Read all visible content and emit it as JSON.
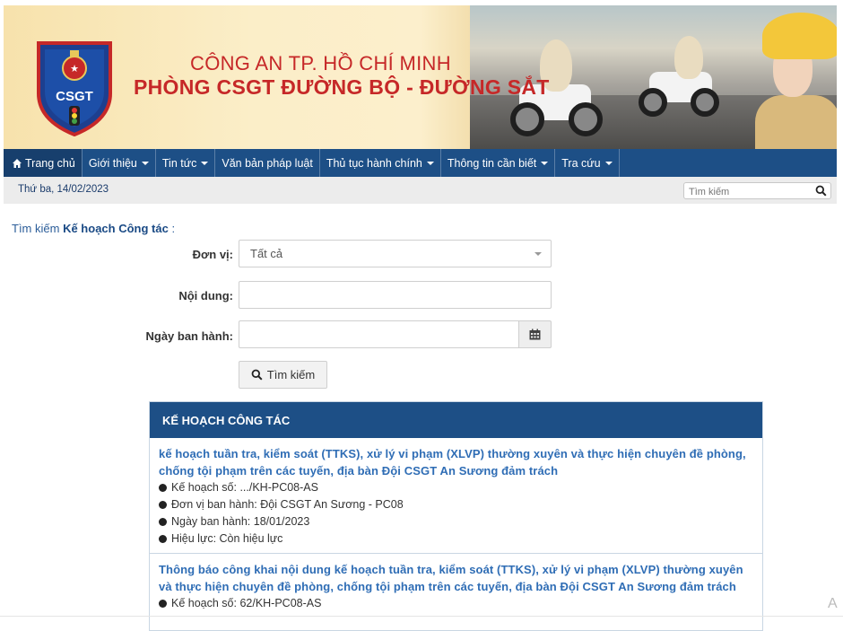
{
  "header": {
    "logo_text": "CSGT",
    "title_line1": "CÔNG AN TP. HỒ CHÍ MINH",
    "title_line2": "PHÒNG CSGT ĐƯỜNG BỘ - ĐƯỜNG SẮT"
  },
  "nav": {
    "items": [
      {
        "label": "Trang chủ",
        "icon": "home-icon",
        "dropdown": false
      },
      {
        "label": "Giới thiệu",
        "dropdown": true
      },
      {
        "label": "Tin tức",
        "dropdown": true
      },
      {
        "label": "Văn bản pháp luật",
        "dropdown": false
      },
      {
        "label": "Thủ tục hành chính",
        "dropdown": true
      },
      {
        "label": "Thông tin cần biết",
        "dropdown": true
      },
      {
        "label": "Tra cứu",
        "dropdown": true
      }
    ]
  },
  "subbar": {
    "date": "Thứ ba, 14/02/2023",
    "search_placeholder": "Tìm kiếm"
  },
  "form": {
    "title_prefix": "Tìm kiếm",
    "title_bold": "Kế hoạch Công tác",
    "title_suffix": " :",
    "unit_label": "Đơn vị:",
    "unit_value": "Tất cả",
    "content_label": "Nội dung:",
    "content_value": "",
    "date_label": "Ngày ban hành:",
    "date_value": "",
    "search_button": "Tìm kiếm"
  },
  "panel": {
    "heading": "KẾ HOẠCH CÔNG TÁC",
    "entries": [
      {
        "title": "kế hoạch tuần tra, kiểm soát (TTKS), xử lý vi phạm (XLVP) thường xuyên và thực hiện chuyên đề phòng, chống tội phạm trên các tuyến, địa bàn Đội CSGT An Sương đảm trách",
        "plan_no": "Kế hoạch số: .../KH-PC08-AS",
        "issuer": "Đơn vị ban hành: Đội CSGT An Sương - PC08",
        "issued_date": "Ngày ban hành: 18/01/2023",
        "status": "Hiệu lực: Còn hiệu lực"
      },
      {
        "title": "Thông báo công khai nội dung kế hoạch tuần tra, kiểm soát (TTKS), xử lý vi phạm (XLVP) thường xuyên và thực hiện chuyên đề phòng, chống tội phạm trên các tuyến, địa bàn Đội CSGT An Sương đảm trách",
        "plan_no": "Kế hoạch số: 62/KH-PC08-AS"
      }
    ]
  },
  "colors": {
    "nav_bg": "#1d4f86",
    "title_red": "#c62828",
    "link_blue": "#2f6db5"
  },
  "corner_text": "A"
}
